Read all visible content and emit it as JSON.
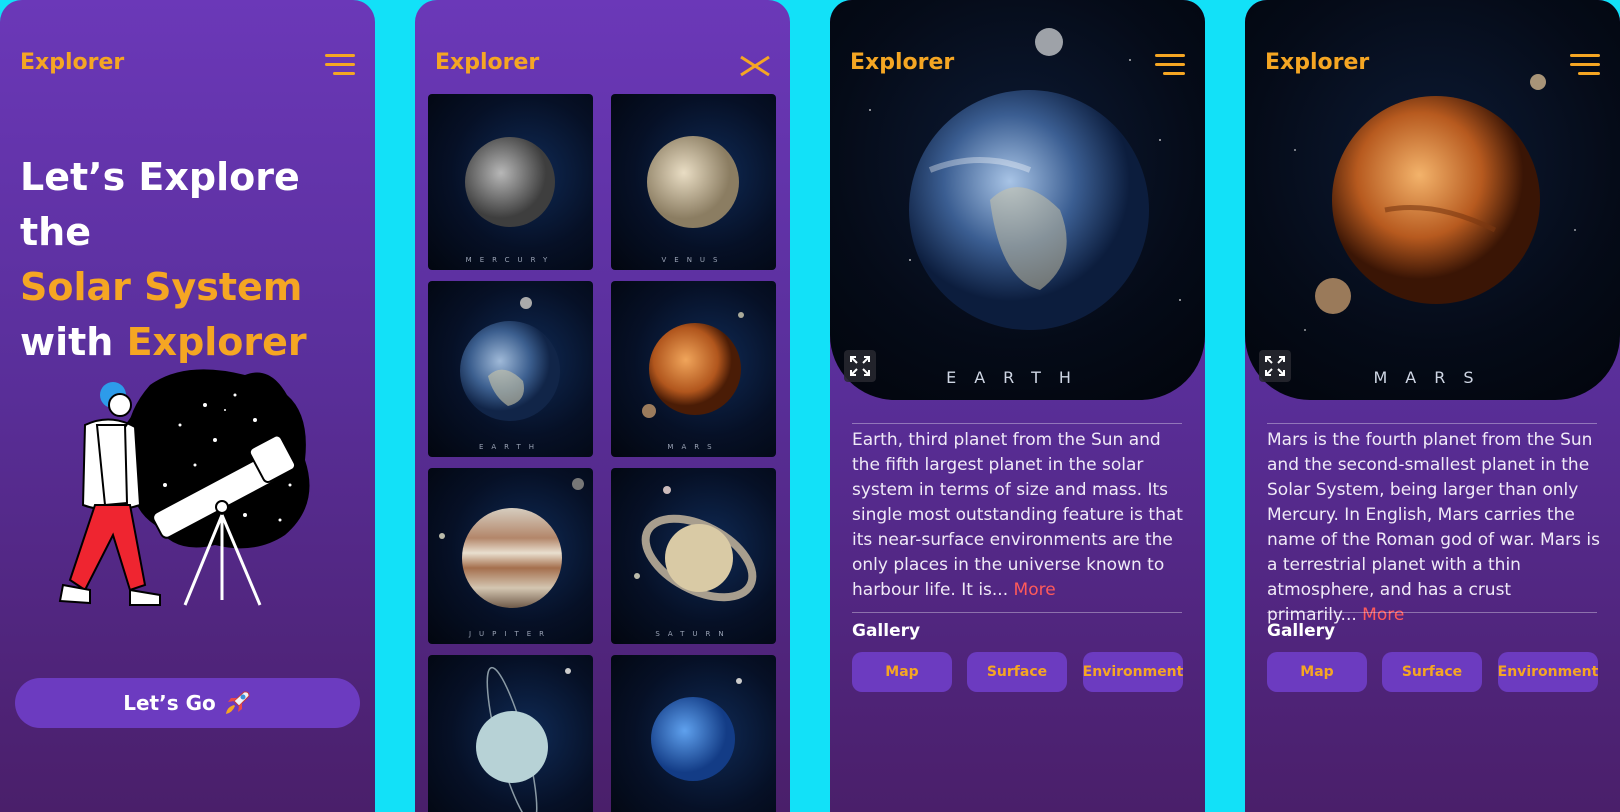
{
  "app": {
    "brand": "Explorer"
  },
  "screen1": {
    "hero_line1": "Let’s Explore the",
    "hero_accent": "Solar System",
    "hero_with": "with",
    "hero_brand": "Explorer",
    "cta_label": "Let’s Go",
    "cta_icon": "rocket-icon"
  },
  "screen2": {
    "tiles": [
      {
        "name": "MERCURY"
      },
      {
        "name": "VENUS"
      },
      {
        "name": "EARTH"
      },
      {
        "name": "MARS"
      },
      {
        "name": "JUPITER"
      },
      {
        "name": "SATURN"
      },
      {
        "name": ""
      },
      {
        "name": ""
      }
    ]
  },
  "earth": {
    "title": "EARTH",
    "description": "Earth, third planet from the Sun and the fifth largest planet in the solar system in terms of size and mass. Its single most outstanding feature is that its near-surface environments are the only places in the universe known to harbour life. It is...",
    "more": "More",
    "gallery_label": "Gallery",
    "gallery": [
      "Map",
      "Surface",
      "Environment"
    ]
  },
  "mars": {
    "title": "MARS",
    "description": "Mars is the fourth planet from the Sun and the second-smallest planet in the Solar System, being larger than only Mercury. In English, Mars carries the name of the Roman god of war. Mars is a terrestrial planet with a thin atmosphere, and has a crust primarily...",
    "more": "More",
    "gallery_label": "Gallery",
    "gallery": [
      "Map",
      "Surface",
      "Environment"
    ]
  },
  "colors": {
    "accent": "#f5a623",
    "background": "#12e1f8",
    "button": "#6c3bc0",
    "link": "#ff5a5a"
  }
}
